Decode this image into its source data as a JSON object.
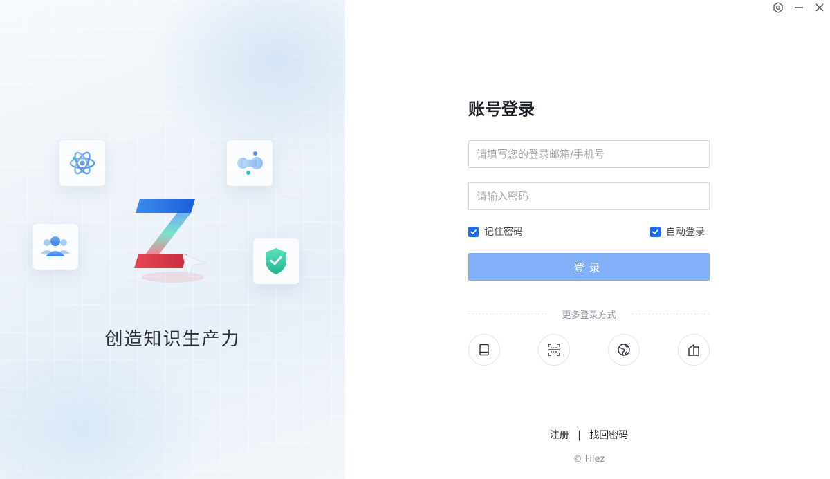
{
  "window": {
    "settings_icon": "settings-hexagon-icon",
    "minimize_icon": "minimize-icon",
    "close_icon": "close-icon"
  },
  "promo": {
    "slogan": "创造知识生产力",
    "tiles": [
      "atom-icon",
      "molecule-icon",
      "people-icon",
      "shield-check-icon"
    ],
    "logo": "filez-z-logo"
  },
  "login": {
    "title": "账号登录",
    "account_placeholder": "请填写您的登录邮箱/手机号",
    "password_placeholder": "请输入密码",
    "remember_label": "记住密码",
    "remember_checked": true,
    "auto_login_label": "自动登录",
    "auto_login_checked": true,
    "submit_label": "登录",
    "more_methods_label": "更多登录方式",
    "methods": [
      "tablet-icon",
      "scan-qr-icon",
      "globe-icon",
      "building-icon"
    ]
  },
  "footer": {
    "register_label": "注册",
    "separator": "|",
    "forgot_label": "找回密码",
    "copyright": "© Filez"
  },
  "colors": {
    "accent": "#1e6ce8",
    "button_disabled": "#82b0f8",
    "text_dark": "#1f2329",
    "text_muted": "#8a9099"
  }
}
